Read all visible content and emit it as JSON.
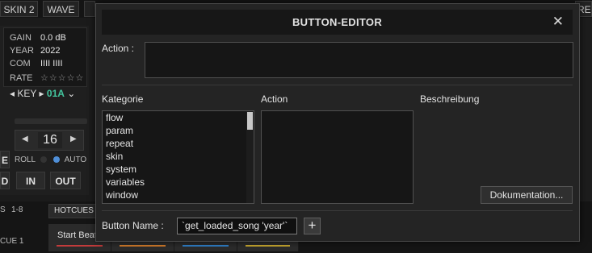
{
  "background": {
    "toolbar": {
      "skin_label": "SKIN 2",
      "wave_label": "WAVE",
      "right_label": "REC"
    },
    "deck_info": {
      "gain_label": "GAIN",
      "gain_value": "0.0 dB",
      "year_label": "YEAR",
      "year_value": "2022",
      "com_label": "COM",
      "com_value": "IIII  IIII",
      "rate_label": "RATE",
      "rate_value": "☆☆☆☆☆",
      "key_label": "KEY",
      "key_value": "01A"
    },
    "loop": {
      "value": "16",
      "roll_label": "ROLL",
      "auto_label": "AUTO"
    },
    "buttons": {
      "in_label": "IN",
      "out_label": "OUT",
      "left_e": "E",
      "left_d": "D"
    },
    "bottom": {
      "range_label": "1-8",
      "s_label": "S",
      "hotcues_label": "HOTCUES",
      "cue_label": "CUE 1",
      "pad1_label": "Start Beat",
      "pad_colors": [
        "#c23b3b",
        "#d07a2a",
        "#2f7fc8",
        "#c8a830"
      ]
    },
    "accent": "#43c59e"
  },
  "dialog": {
    "title": "BUTTON-EDITOR",
    "action_label": "Action :",
    "action_value": "",
    "kategorie_header": "Kategorie",
    "action_header": "Action",
    "beschreibung_header": "Beschreibung",
    "kategorie_items": [
      "flow",
      "param",
      "repeat",
      "skin",
      "system",
      "variables",
      "window"
    ],
    "documentation_button": "Dokumentation...",
    "button_name_label": "Button Name :",
    "button_name_value": "`get_loaded_song 'year'`",
    "add_button": "+"
  }
}
